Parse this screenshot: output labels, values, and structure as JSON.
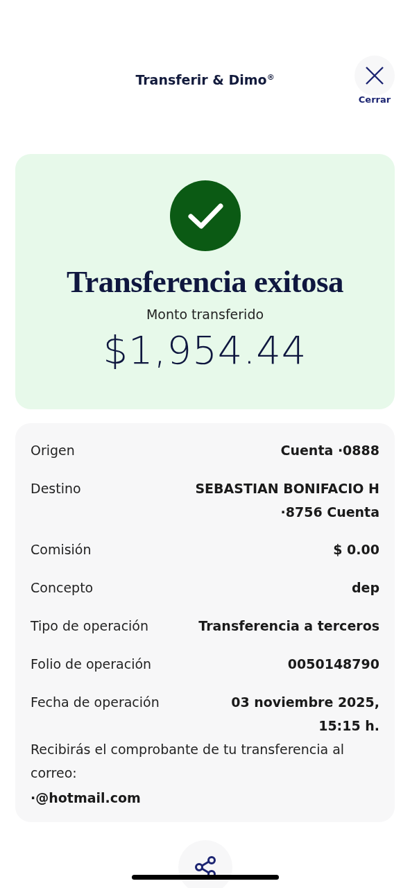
{
  "header": {
    "title": "Transferir & Dimo$^{®}$",
    "close_label": "Cerrar"
  },
  "result": {
    "title": "Transferencia exitosa",
    "amount_label": "Monto transferido",
    "amount": "$1,954.44"
  },
  "details": [
    {
      "label": "Origen",
      "value": "Cuenta ·0888"
    },
    {
      "label": "Destino",
      "value": "SEBASTIAN BONIFACIO H ·8756 Cuenta"
    },
    {
      "label": "Comisión",
      "value": "$ 0.00"
    },
    {
      "label": "Concepto",
      "value": "dep"
    },
    {
      "label": "Tipo de operación",
      "value": "Transferencia a terceros"
    },
    {
      "label": "Folio de operación",
      "value": "0050148790"
    },
    {
      "label": "Fecha de operación",
      "value": "03 noviembre 2025, 15:15 h."
    }
  ],
  "receipt_note": "Recibirás el comprobante de tu transferencia al correo:",
  "email": "·@hotmail.com"
}
